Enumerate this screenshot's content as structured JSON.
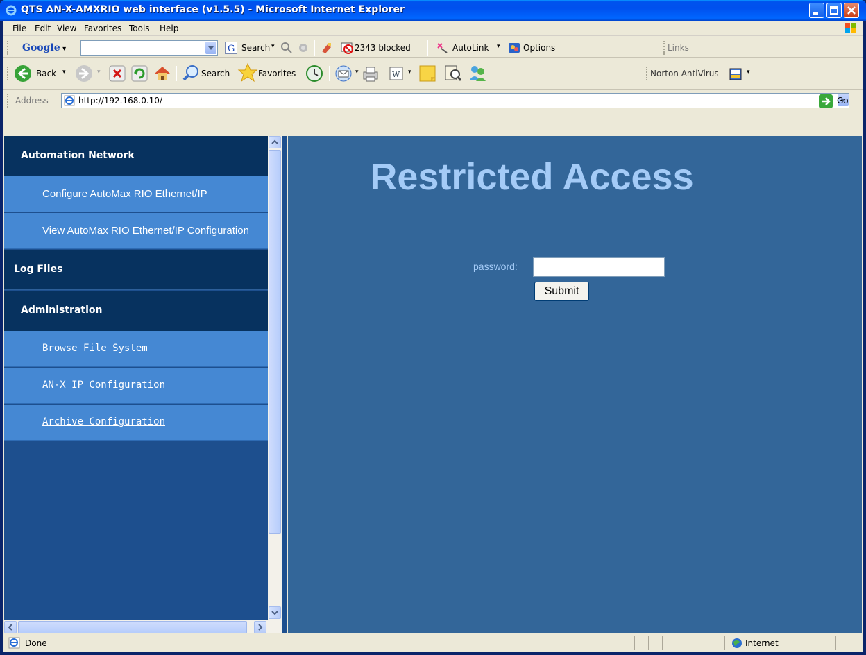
{
  "window": {
    "title": "QTS AN-X-AMXRIO web interface (v1.5.5) - Microsoft Internet Explorer"
  },
  "menu": [
    "File",
    "Edit",
    "View",
    "Favorites",
    "Tools",
    "Help"
  ],
  "google_toolbar": {
    "logo": "Google",
    "search_label": "Search",
    "blocked_label": "2343 blocked",
    "autolink_label": "AutoLink",
    "options_label": "Options",
    "links_label": "Links"
  },
  "std_toolbar": {
    "back_label": "Back",
    "search_label": "Search",
    "favorites_label": "Favorites",
    "norton_label": "Norton AntiVirus"
  },
  "address": {
    "label": "Address",
    "url": "http://192.168.0.10/",
    "go_label": "Go"
  },
  "nav": {
    "sections": [
      {
        "title": "Automation Network",
        "expanded": true,
        "items": [
          "Configure AutoMax RIO Ethernet/IP",
          "View AutoMax RIO Ethernet/IP Configuration"
        ]
      },
      {
        "title": "Log Files",
        "expanded": false,
        "items": []
      },
      {
        "title": "Administration",
        "expanded": true,
        "items": [
          "Browse File System",
          "AN-X IP Configuration",
          "Archive Configuration"
        ]
      }
    ]
  },
  "main": {
    "heading": "Restricted Access",
    "password_label": "password:",
    "password_value": "",
    "submit_label": "Submit"
  },
  "status": {
    "text": "Done",
    "zone": "Internet"
  },
  "colors": {
    "nav_header": "#07325f",
    "nav_item": "#4588d3",
    "main_bg": "#336699",
    "heading": "#a4cbf7"
  }
}
